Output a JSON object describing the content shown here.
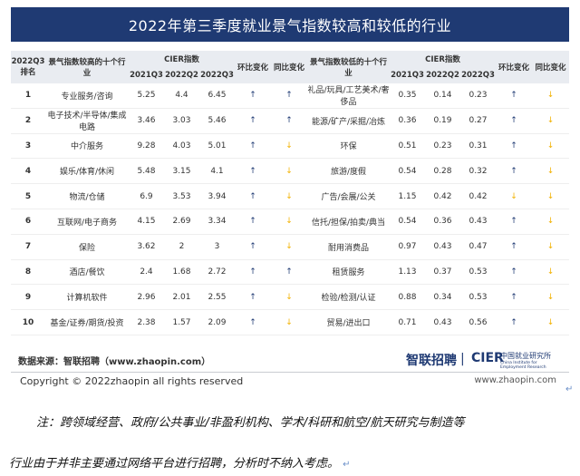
{
  "banner": {
    "title": "2022年第三季度就业景气指数较高和较低的行业"
  },
  "table": {
    "header": {
      "rank": "2022Q3排名",
      "high_industry": "景气指数较高的十个行业",
      "cier_label": "CIER指数",
      "low_industry": "景气指数较低的十个行业",
      "q1": "2021Q3",
      "q2": "2022Q2",
      "q3": "2022Q3",
      "mom": "环比变化",
      "yoy": "同比变化"
    },
    "rows": [
      {
        "rank": "1",
        "hi": "专业服务/咨询",
        "hv1": "5.25",
        "hv2": "4.4",
        "hv3": "6.45",
        "hmom": "↑",
        "hyoy": "↑",
        "lo": "礼品/玩具/工艺美术/奢侈品",
        "lv1": "0.35",
        "lv2": "0.14",
        "lv3": "0.23",
        "lmom": "↑",
        "lyoy": "↓"
      },
      {
        "rank": "2",
        "hi": "电子技术/半导体/集成电路",
        "hv1": "3.46",
        "hv2": "3.03",
        "hv3": "5.46",
        "hmom": "↑",
        "hyoy": "↑",
        "lo": "能源/矿产/采掘/冶炼",
        "lv1": "0.36",
        "lv2": "0.19",
        "lv3": "0.27",
        "lmom": "↑",
        "lyoy": "↓"
      },
      {
        "rank": "3",
        "hi": "中介服务",
        "hv1": "9.28",
        "hv2": "4.03",
        "hv3": "5.01",
        "hmom": "↑",
        "hyoy": "↓",
        "lo": "环保",
        "lv1": "0.51",
        "lv2": "0.23",
        "lv3": "0.31",
        "lmom": "↑",
        "lyoy": "↓"
      },
      {
        "rank": "4",
        "hi": "娱乐/体育/休闲",
        "hv1": "5.48",
        "hv2": "3.15",
        "hv3": "4.1",
        "hmom": "↑",
        "hyoy": "↓",
        "lo": "旅游/度假",
        "lv1": "0.54",
        "lv2": "0.28",
        "lv3": "0.32",
        "lmom": "↑",
        "lyoy": "↓"
      },
      {
        "rank": "5",
        "hi": "物流/仓储",
        "hv1": "6.9",
        "hv2": "3.53",
        "hv3": "3.94",
        "hmom": "↑",
        "hyoy": "↓",
        "lo": "广告/会展/公关",
        "lv1": "1.15",
        "lv2": "0.42",
        "lv3": "0.42",
        "lmom": "↓",
        "lyoy": "↓"
      },
      {
        "rank": "6",
        "hi": "互联网/电子商务",
        "hv1": "4.15",
        "hv2": "2.69",
        "hv3": "3.34",
        "hmom": "↑",
        "hyoy": "↓",
        "lo": "信托/担保/拍卖/典当",
        "lv1": "0.54",
        "lv2": "0.36",
        "lv3": "0.43",
        "lmom": "↑",
        "lyoy": "↓"
      },
      {
        "rank": "7",
        "hi": "保险",
        "hv1": "3.62",
        "hv2": "2",
        "hv3": "3",
        "hmom": "↑",
        "hyoy": "↓",
        "lo": "耐用消费品",
        "lv1": "0.97",
        "lv2": "0.43",
        "lv3": "0.47",
        "lmom": "↑",
        "lyoy": "↓"
      },
      {
        "rank": "8",
        "hi": "酒店/餐饮",
        "hv1": "2.4",
        "hv2": "1.68",
        "hv3": "2.72",
        "hmom": "↑",
        "hyoy": "↑",
        "lo": "租赁服务",
        "lv1": "1.13",
        "lv2": "0.37",
        "lv3": "0.53",
        "lmom": "↑",
        "lyoy": "↓"
      },
      {
        "rank": "9",
        "hi": "计算机软件",
        "hv1": "2.96",
        "hv2": "2.01",
        "hv3": "2.55",
        "hmom": "↑",
        "hyoy": "↓",
        "lo": "检验/检测/认证",
        "lv1": "0.88",
        "lv2": "0.34",
        "lv3": "0.53",
        "lmom": "↑",
        "lyoy": "↓"
      },
      {
        "rank": "10",
        "hi": "基金/证券/期货/投资",
        "hv1": "2.38",
        "hv2": "1.57",
        "hv3": "2.09",
        "hmom": "↑",
        "hyoy": "↓",
        "lo": "贸易/进出口",
        "lv1": "0.71",
        "lv2": "0.43",
        "lv3": "0.56",
        "lmom": "↑",
        "lyoy": "↓"
      }
    ]
  },
  "source": "数据来源：智联招聘（www.zhaopin.com）",
  "logo_zhaopin": "智联招聘",
  "logo_sep": "|",
  "logo_cier": "CIER",
  "logo_cier_cn": "中国就业研究所",
  "logo_cier_en": "China Institute for Employment Research",
  "copyright": "Copyright ©  2022zhaopin all rights reserved",
  "site": "www.zhaopin.com",
  "return_mark": "↵",
  "note_line1": "注：跨领域经营、政府/公共事业/非盈利机构、学术/科研和航空/航天研究与制造等",
  "note_line2": "行业由于并非主要通过网络平台进行招聘，分析时不纳入考虑。",
  "colors": {
    "banner": "#1f3a73",
    "up": "#1f3a73",
    "down": "#f2b100",
    "header_bg": "#e9ecf1"
  }
}
